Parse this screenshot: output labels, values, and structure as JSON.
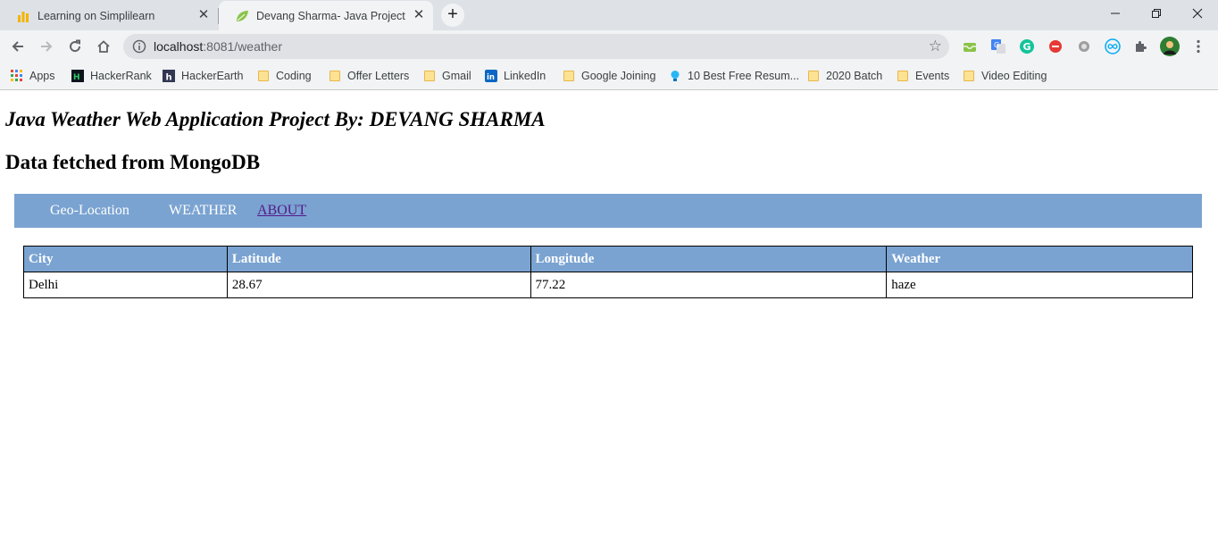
{
  "browser": {
    "tabs": [
      {
        "title": "Learning on Simplilearn",
        "icon": "simplilearn-icon",
        "active": false
      },
      {
        "title": "Devang Sharma- Java Project",
        "icon": "spring-leaf-icon",
        "active": true
      }
    ],
    "address": {
      "host": "localhost",
      "path": ":8081/weather"
    },
    "bookmarks": [
      {
        "label": "Apps",
        "icon": "apps-grid-icon"
      },
      {
        "label": "HackerRank",
        "icon": "hackerrank-icon"
      },
      {
        "label": "HackerEarth",
        "icon": "hackerearth-icon"
      },
      {
        "label": "Coding",
        "icon": "folder-icon"
      },
      {
        "label": "Offer Letters",
        "icon": "folder-icon"
      },
      {
        "label": "Gmail",
        "icon": "folder-icon"
      },
      {
        "label": "LinkedIn",
        "icon": "linkedin-icon"
      },
      {
        "label": "Google Joining",
        "icon": "folder-icon"
      },
      {
        "label": "10 Best Free Resum...",
        "icon": "bulb-icon"
      },
      {
        "label": "2020 Batch",
        "icon": "folder-icon"
      },
      {
        "label": "Events",
        "icon": "folder-icon"
      },
      {
        "label": "Video Editing",
        "icon": "folder-icon"
      }
    ]
  },
  "page": {
    "title": "Java Weather Web Application Project By: DEVANG SHARMA",
    "subtitle": "Data fetched from MongoDB",
    "nav": [
      "Geo-Location",
      "WEATHER",
      "ABOUT"
    ],
    "table": {
      "headers": [
        "City",
        "Latitude",
        "Longitude",
        "Weather"
      ],
      "rows": [
        [
          "Delhi",
          "28.67",
          "77.22",
          "haze"
        ]
      ]
    }
  },
  "colors": {
    "navbar": "#7aa3d1",
    "tabstrip": "#dee1e6",
    "toolbar": "#f1f3f4"
  }
}
